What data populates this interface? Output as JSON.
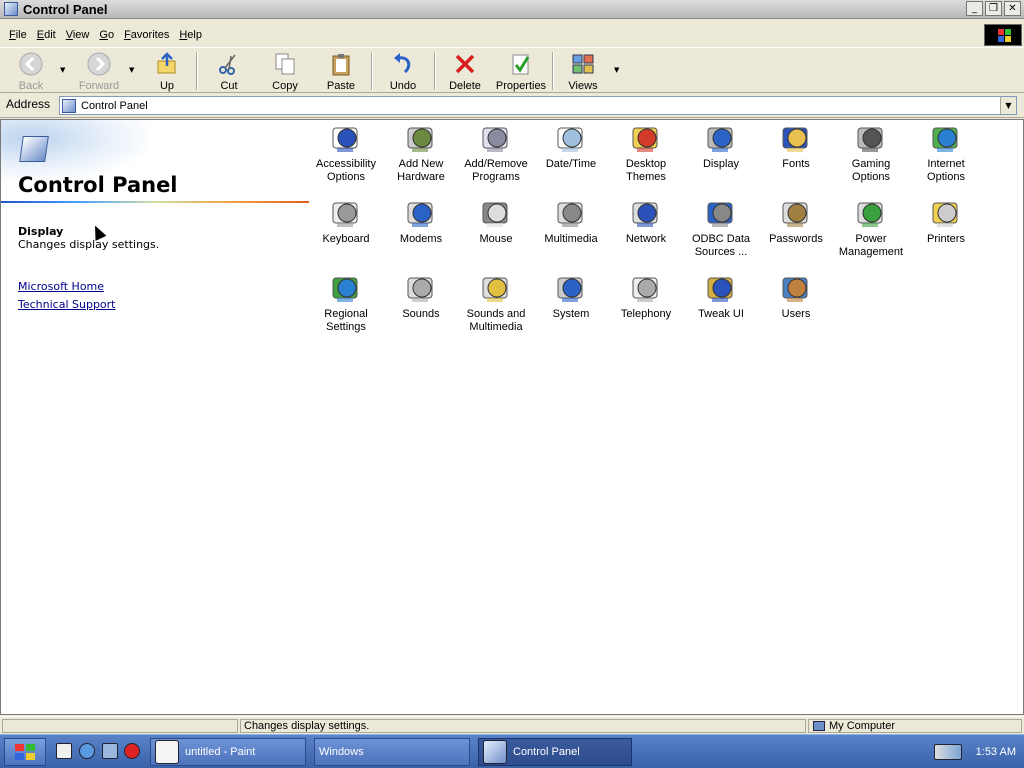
{
  "window": {
    "title": "Control Panel"
  },
  "menu": [
    "File",
    "Edit",
    "View",
    "Go",
    "Favorites",
    "Help"
  ],
  "toolbar": {
    "back": "Back",
    "forward": "Forward",
    "up": "Up",
    "cut": "Cut",
    "copy": "Copy",
    "paste": "Paste",
    "undo": "Undo",
    "delete": "Delete",
    "properties": "Properties",
    "views": "Views"
  },
  "address": {
    "label": "Address",
    "value": "Control Panel"
  },
  "left": {
    "title": "Control Panel",
    "selected_name": "Display",
    "selected_desc": "Changes display settings.",
    "links": [
      "Microsoft Home",
      "Technical Support"
    ]
  },
  "items": [
    {
      "label": "Accessibility\nOptions",
      "icon": "accessibility-icon"
    },
    {
      "label": "Add New\nHardware",
      "icon": "add-hardware-icon"
    },
    {
      "label": "Add/Remove\nPrograms",
      "icon": "add-remove-programs-icon"
    },
    {
      "label": "Date/Time",
      "icon": "date-time-icon"
    },
    {
      "label": "Desktop\nThemes",
      "icon": "desktop-themes-icon"
    },
    {
      "label": "Display",
      "icon": "display-icon"
    },
    {
      "label": "Fonts",
      "icon": "fonts-icon"
    },
    {
      "label": "Gaming\nOptions",
      "icon": "gaming-icon"
    },
    {
      "label": "Internet\nOptions",
      "icon": "internet-options-icon"
    },
    {
      "label": "Keyboard",
      "icon": "keyboard-icon"
    },
    {
      "label": "Modems",
      "icon": "modems-icon"
    },
    {
      "label": "Mouse",
      "icon": "mouse-icon"
    },
    {
      "label": "Multimedia",
      "icon": "multimedia-icon"
    },
    {
      "label": "Network",
      "icon": "network-icon"
    },
    {
      "label": "ODBC Data\nSources ...",
      "icon": "odbc-icon"
    },
    {
      "label": "Passwords",
      "icon": "passwords-icon"
    },
    {
      "label": "Power\nManagement",
      "icon": "power-icon"
    },
    {
      "label": "Printers",
      "icon": "printers-icon"
    },
    {
      "label": "Regional\nSettings",
      "icon": "regional-icon"
    },
    {
      "label": "Sounds",
      "icon": "sounds-icon"
    },
    {
      "label": "Sounds and\nMultimedia",
      "icon": "sounds-multimedia-icon"
    },
    {
      "label": "System",
      "icon": "system-icon"
    },
    {
      "label": "Telephony",
      "icon": "telephony-icon"
    },
    {
      "label": "Tweak UI",
      "icon": "tweak-ui-icon"
    },
    {
      "label": "Users",
      "icon": "users-icon"
    }
  ],
  "status": {
    "text": "Changes display settings.",
    "zone": "My Computer"
  },
  "taskbar": {
    "tasks": [
      "untitled - Paint",
      "Windows",
      "Control Panel"
    ],
    "clock": "1:53 AM"
  },
  "colors": {
    "link": "#00008b",
    "taskbar": "#4a72bc",
    "titlebar": "#c8c8c8"
  }
}
